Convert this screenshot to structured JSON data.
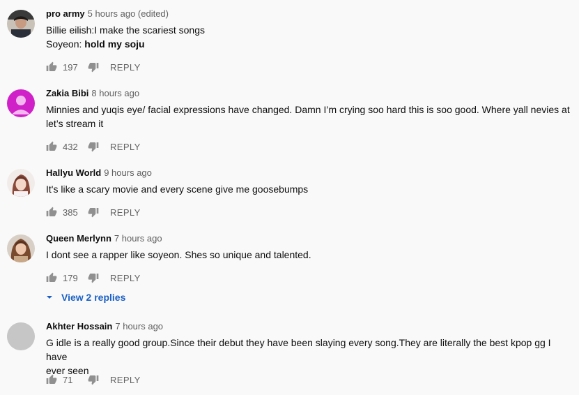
{
  "comments": [
    {
      "author": "pro army",
      "time": "5 hours ago (edited)",
      "line1": "Billie eilish:I make the scariest songs",
      "line2_prefix": "Soyeon: ",
      "line2_bold": "hold my soju",
      "likes": "197",
      "reply": "REPLY"
    },
    {
      "author": "Zakia Bibi",
      "time": "8 hours ago",
      "line1": "Minnies and yuqis eye/ facial expressions have changed. Damn I’m crying soo hard this is soo good. Where yall nevies at",
      "line2": "let’s stream it",
      "likes": "432",
      "reply": "REPLY"
    },
    {
      "author": "Hallyu World",
      "time": "9 hours ago",
      "line1": "It's like a scary movie and every scene give me goosebumps",
      "likes": "385",
      "reply": "REPLY"
    },
    {
      "author": "Queen Merlynn",
      "time": "7 hours ago",
      "line1": "I dont see a rapper like soyeon. Shes so unique and talented.",
      "likes": "179",
      "reply": "REPLY",
      "view_replies": "View 2 replies"
    },
    {
      "author": "Akhter Hossain",
      "time": "7 hours ago",
      "line1": "G idle is a really good group.Since their debut they have been slaying every song.They are literally the best kpop gg I have",
      "line2": "ever seen",
      "likes": "71",
      "reply": "REPLY"
    }
  ],
  "colors": {
    "background": "#f9f9f9",
    "link_blue": "#1a60c6",
    "muted": "#606060",
    "default_avatar_magenta": "#d020c8"
  }
}
